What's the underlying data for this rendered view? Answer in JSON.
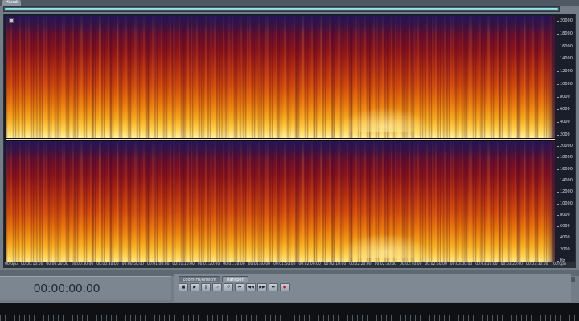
{
  "window": {
    "top_tab": "Haupt"
  },
  "spectrogram": {
    "channels": 2,
    "color_map": [
      "#2b1640",
      "#6b0f2a",
      "#b12a0e",
      "#e97708",
      "#ffd24a",
      "#fff2a0"
    ],
    "freq_scale": {
      "top_channel": [
        "20000",
        "18000",
        "16000",
        "14000",
        "12000",
        "10000",
        "8000",
        "6000",
        "4000",
        "2000"
      ],
      "bottom_channel": [
        "20000",
        "18000",
        "16000",
        "14000",
        "12000",
        "10000",
        "8000",
        "6000",
        "4000",
        "2000",
        "Hz"
      ]
    }
  },
  "time_ruler": {
    "start_label": "00:0pu",
    "labels": [
      "00:00:10:00",
      "00:00:20:00",
      "00:00:30:00",
      "00:00:40:00",
      "00:00:50:00",
      "00:01:00:00",
      "00:01:10:00",
      "00:01:20:00",
      "00:01:30:00",
      "00:01:40:00",
      "00:01:50:00",
      "00:02:00:00",
      "00:02:10:00",
      "00:02:20:00",
      "00:02:30:00",
      "00:02:40:00",
      "00:02:50:00",
      "00:03:00:00",
      "00:03:10:00",
      "00:03:20:00",
      "00:03:30:00"
    ],
    "end_label": "00:0pu"
  },
  "time_display": {
    "value": "00:00:00:00"
  },
  "panels": {
    "zoom_tab": "Zoom(H)/Ansicht",
    "transport_tab": "Transport"
  },
  "transport": {
    "buttons": [
      {
        "name": "stop",
        "glyph": "■"
      },
      {
        "name": "play",
        "glyph": "▶"
      },
      {
        "name": "pause",
        "glyph": "‖"
      },
      {
        "name": "play-from",
        "glyph": "▷"
      },
      {
        "name": "loop",
        "glyph": "↺"
      },
      {
        "name": "go-start",
        "glyph": "⏮"
      },
      {
        "name": "rewind",
        "glyph": "◀◀"
      },
      {
        "name": "forward",
        "glyph": "▶▶"
      },
      {
        "name": "go-end",
        "glyph": "⏭"
      },
      {
        "name": "record",
        "glyph": "●"
      }
    ]
  }
}
